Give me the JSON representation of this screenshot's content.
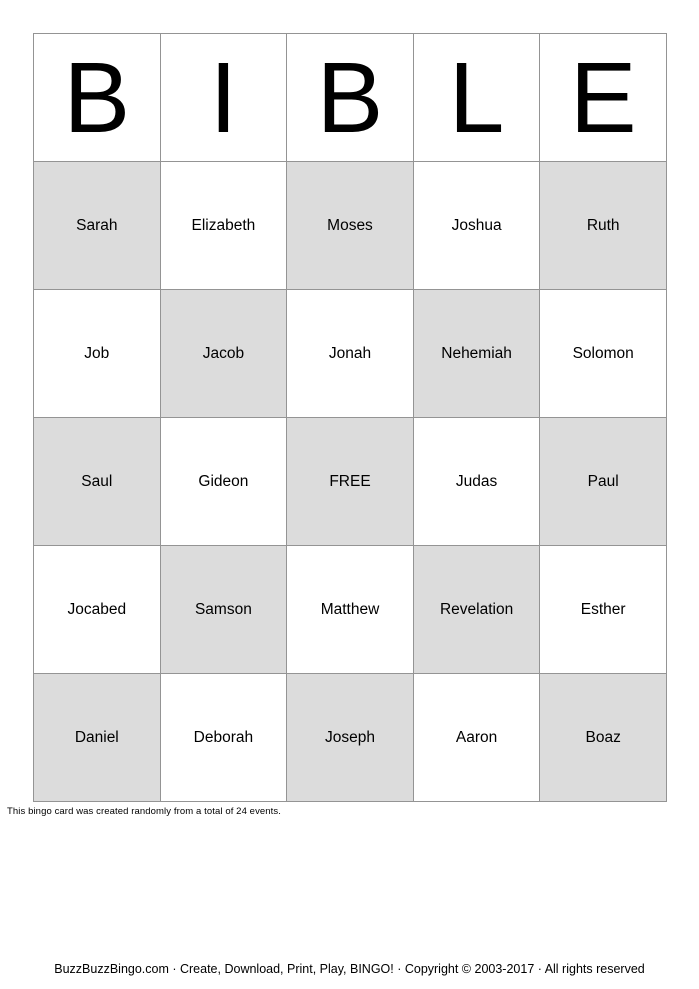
{
  "card": {
    "header_letters": [
      "B",
      "I",
      "B",
      "L",
      "E"
    ],
    "rows": [
      [
        {
          "label": "Sarah",
          "shaded": true
        },
        {
          "label": "Elizabeth",
          "shaded": false
        },
        {
          "label": "Moses",
          "shaded": true
        },
        {
          "label": "Joshua",
          "shaded": false
        },
        {
          "label": "Ruth",
          "shaded": true
        }
      ],
      [
        {
          "label": "Job",
          "shaded": false
        },
        {
          "label": "Jacob",
          "shaded": true
        },
        {
          "label": "Jonah",
          "shaded": false
        },
        {
          "label": "Nehemiah",
          "shaded": true
        },
        {
          "label": "Solomon",
          "shaded": false
        }
      ],
      [
        {
          "label": "Saul",
          "shaded": true
        },
        {
          "label": "Gideon",
          "shaded": false
        },
        {
          "label": "FREE",
          "shaded": true
        },
        {
          "label": "Judas",
          "shaded": false
        },
        {
          "label": "Paul",
          "shaded": true
        }
      ],
      [
        {
          "label": "Jocabed",
          "shaded": false
        },
        {
          "label": "Samson",
          "shaded": true
        },
        {
          "label": "Matthew",
          "shaded": false
        },
        {
          "label": "Revelation",
          "shaded": true
        },
        {
          "label": "Esther",
          "shaded": false
        }
      ],
      [
        {
          "label": "Daniel",
          "shaded": true
        },
        {
          "label": "Deborah",
          "shaded": false
        },
        {
          "label": "Joseph",
          "shaded": true
        },
        {
          "label": "Aaron",
          "shaded": false
        },
        {
          "label": "Boaz",
          "shaded": true
        }
      ]
    ],
    "note": "This bingo card was created randomly from a total of 24 events."
  },
  "footer": {
    "text": "BuzzBuzzBingo.com · Create, Download, Print, Play, BINGO! · Copyright © 2003-2017 · All rights reserved"
  },
  "colors": {
    "shaded_cell": "#dcdcdc",
    "cell_border": "#949494",
    "text": "#000000",
    "background": "#ffffff"
  }
}
